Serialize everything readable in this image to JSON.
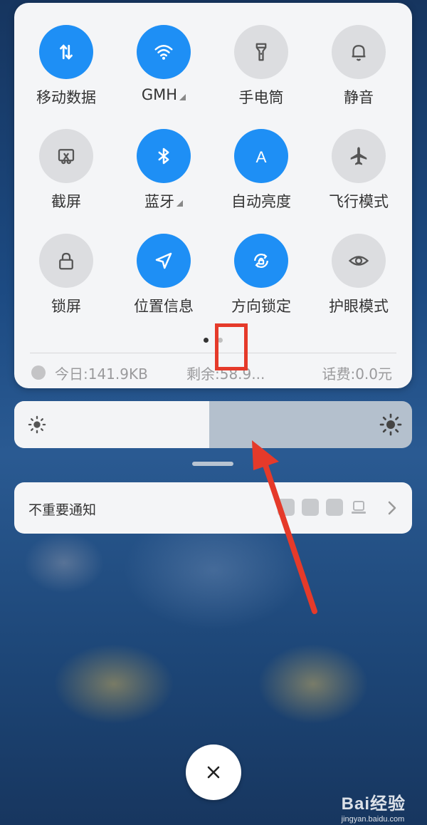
{
  "quick_settings": {
    "tiles": [
      {
        "label": "移动数据",
        "icon": "mobile-data-icon",
        "on": true
      },
      {
        "label": "GMH",
        "icon": "wifi-icon",
        "on": true,
        "expandable": true
      },
      {
        "label": "手电筒",
        "icon": "flashlight-icon",
        "on": false
      },
      {
        "label": "静音",
        "icon": "bell-icon",
        "on": false
      },
      {
        "label": "截屏",
        "icon": "screenshot-icon",
        "on": false
      },
      {
        "label": "蓝牙",
        "icon": "bluetooth-icon",
        "on": true,
        "expandable": true
      },
      {
        "label": "自动亮度",
        "icon": "auto-brightness-icon",
        "on": true
      },
      {
        "label": "飞行模式",
        "icon": "airplane-icon",
        "on": false
      },
      {
        "label": "锁屏",
        "icon": "lock-icon",
        "on": false
      },
      {
        "label": "位置信息",
        "icon": "location-icon",
        "on": true
      },
      {
        "label": "方向锁定",
        "icon": "rotation-lock-icon",
        "on": true
      },
      {
        "label": "护眼模式",
        "icon": "eye-icon",
        "on": false
      }
    ],
    "page_indicator": {
      "pages": 2,
      "current": 1
    }
  },
  "status": {
    "today": "今日:141.9KB",
    "remaining": "剩余:58.9...",
    "fee": "话费:0.0元"
  },
  "brightness": {
    "level": 0.49
  },
  "notification": {
    "label": "不重要通知"
  },
  "colors": {
    "accent": "#1e8ff5",
    "annotation": "#e53a2a"
  },
  "watermark": {
    "brand": "Bai经验",
    "url": "jingyan.baidu.com"
  }
}
